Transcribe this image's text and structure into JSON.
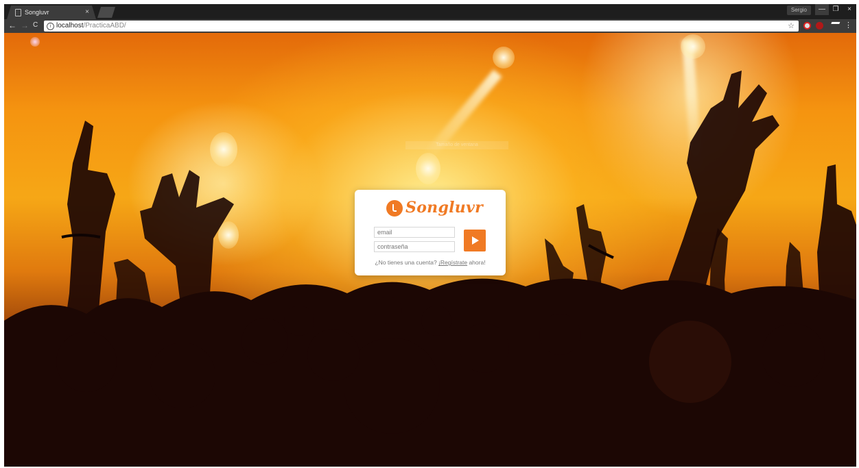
{
  "browser": {
    "tab_title": "Songluvr",
    "tab_close": "×",
    "user_button": "Sergio",
    "window_controls": {
      "minimize": "—",
      "restore": "❐",
      "close": "×"
    },
    "url_host": "localhost",
    "url_path": "/PracticaABD/",
    "nav": {
      "back": "←",
      "forward": "→",
      "reload": "C"
    },
    "star": "☆",
    "menu": "⋮"
  },
  "page": {
    "faint_label": "Tamaño de ventana",
    "login": {
      "logo_text": "Songluvr",
      "email_placeholder": "email",
      "password_placeholder": "contraseña",
      "signup_prefix": "¿No tienes una cuenta? ",
      "signup_link": "¡Regístrate",
      "signup_suffix": " ahora!"
    }
  },
  "colors": {
    "brand": "#f07a24",
    "card": "#ffffff"
  }
}
